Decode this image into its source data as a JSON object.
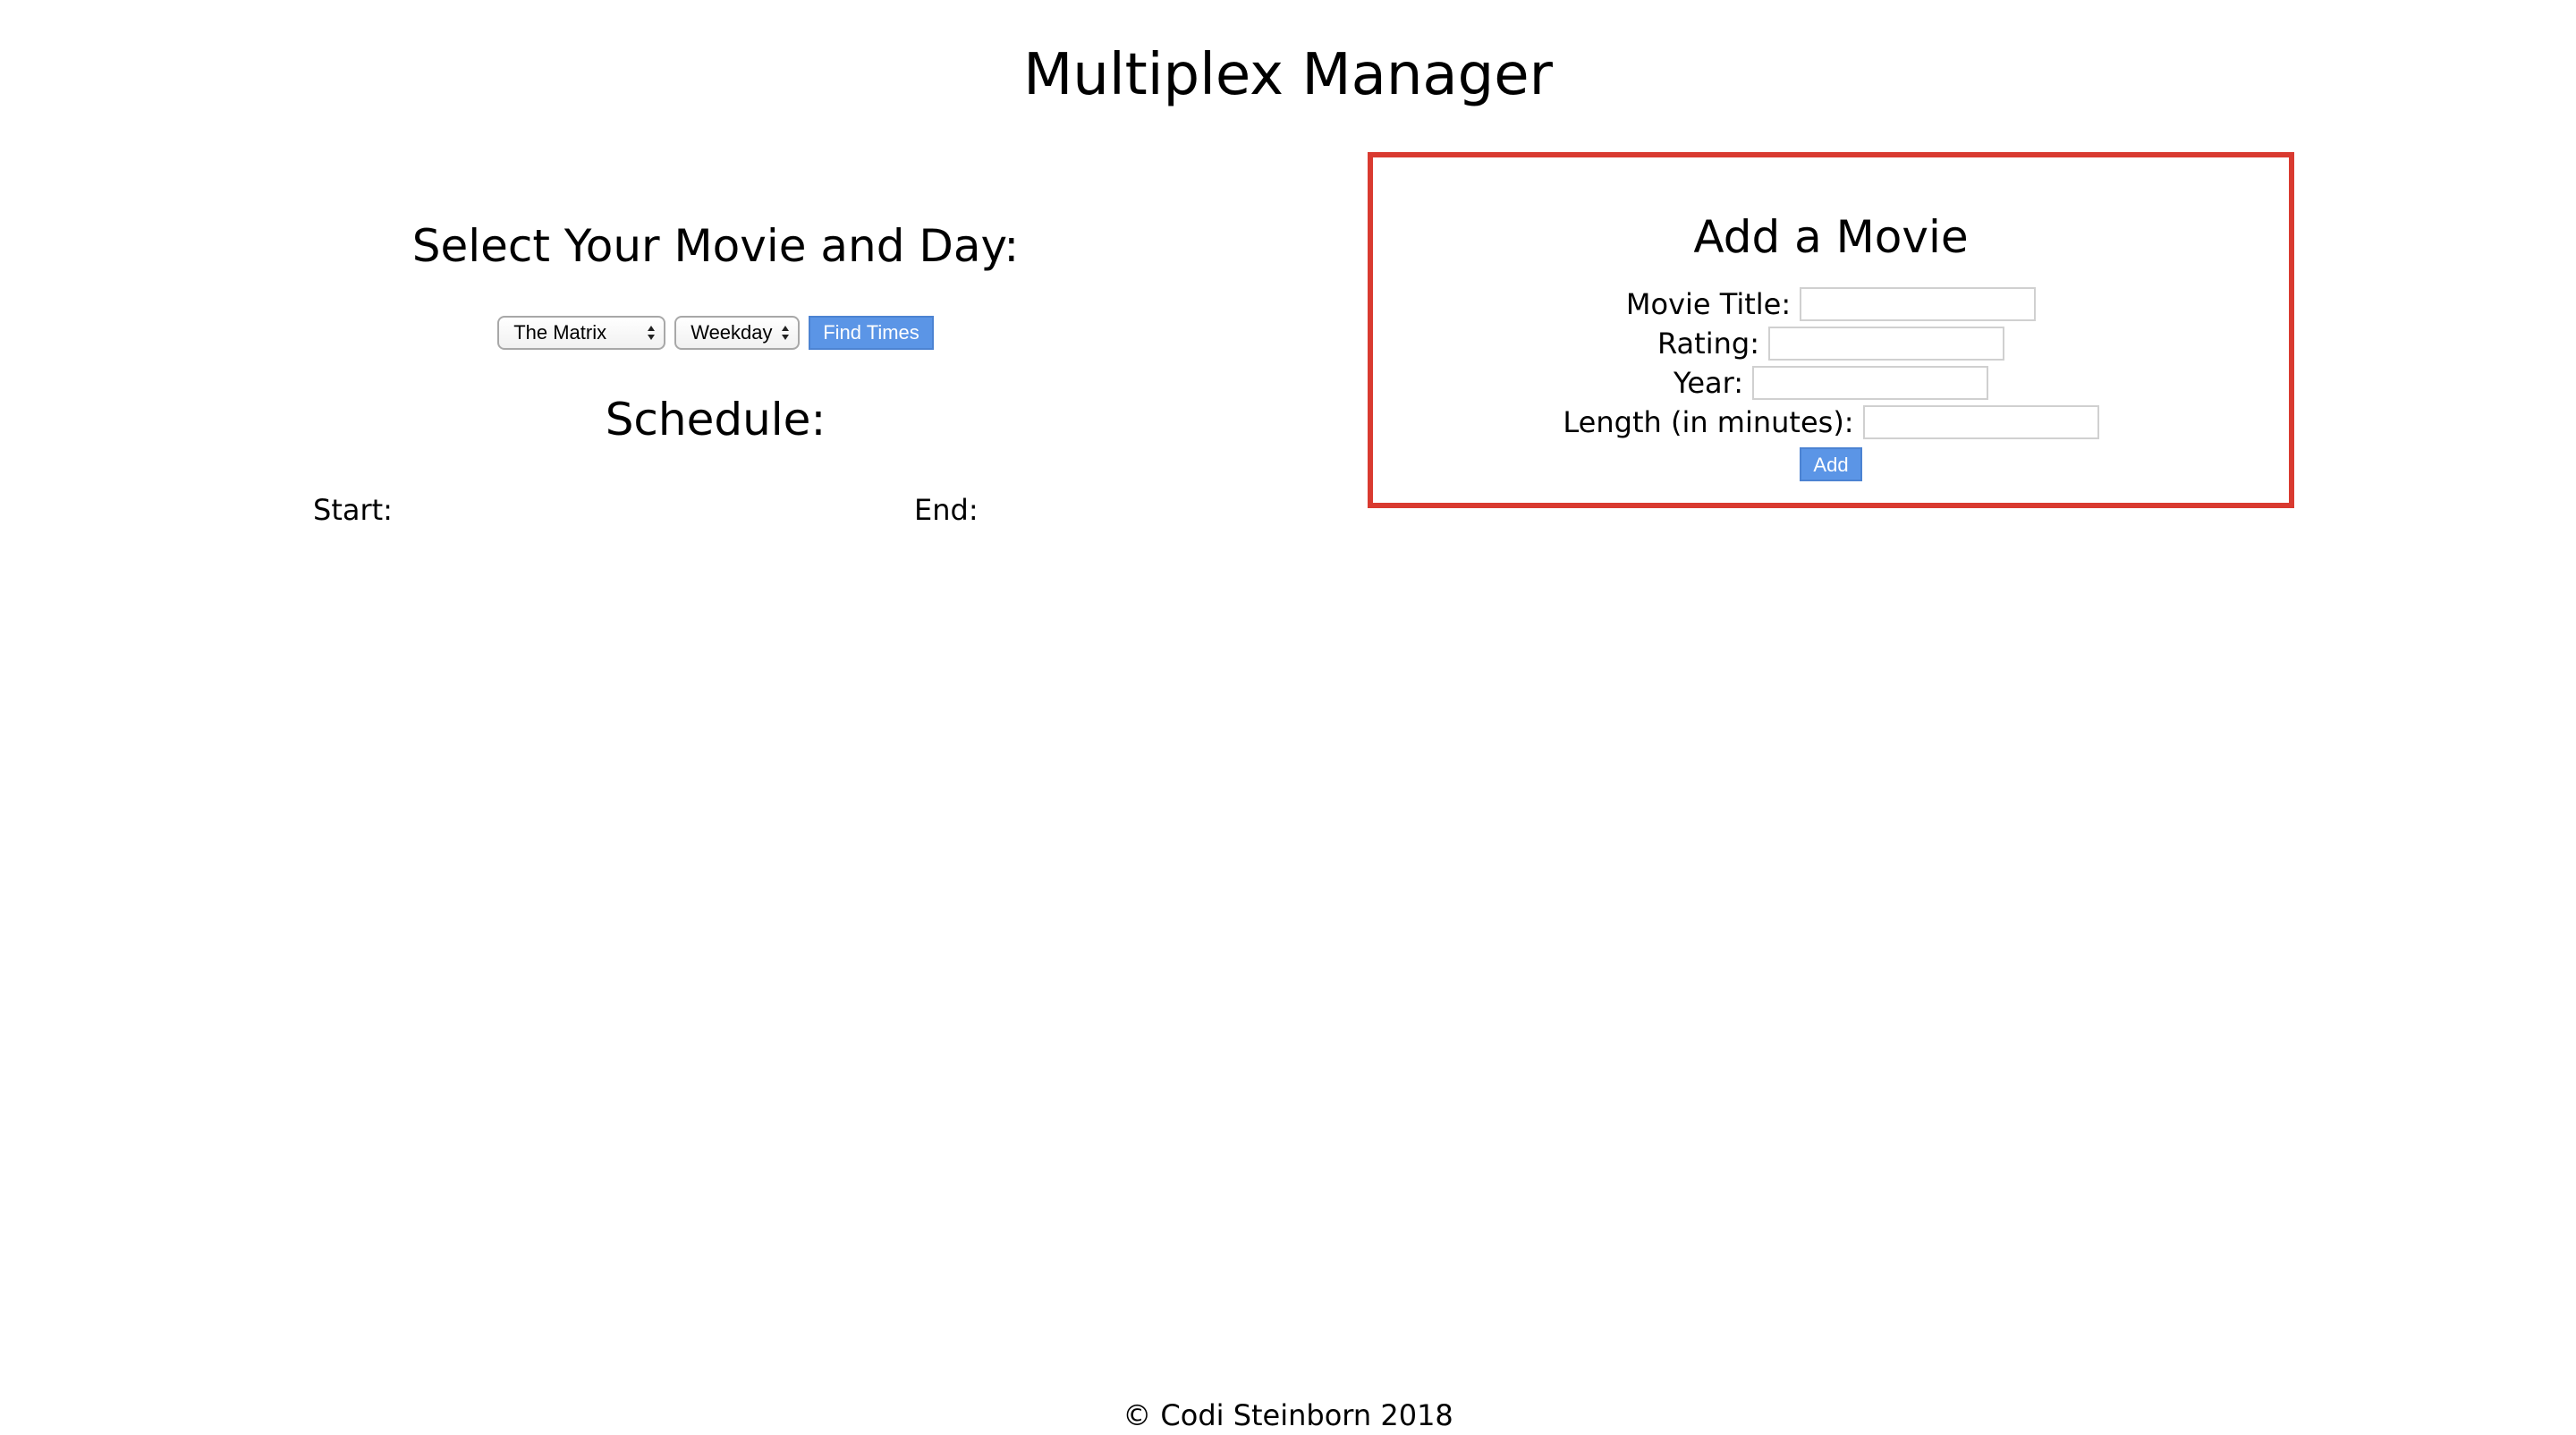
{
  "app": {
    "title": "Multiplex Manager"
  },
  "selector": {
    "heading": "Select Your Movie and Day:",
    "movie_value": "The Matrix",
    "day_value": "Weekday",
    "find_button": "Find Times"
  },
  "schedule": {
    "heading": "Schedule:",
    "start_label": "Start:",
    "end_label": "End:"
  },
  "add_movie": {
    "heading": "Add a Movie",
    "fields": {
      "title_label": "Movie Title:",
      "title_value": "",
      "rating_label": "Rating:",
      "rating_value": "",
      "year_label": "Year:",
      "year_value": "",
      "length_label": "Length (in minutes):",
      "length_value": ""
    },
    "add_button": "Add"
  },
  "footer": {
    "copyright": "© Codi Steinborn 2018"
  },
  "colors": {
    "button_blue": "#5b95e6",
    "panel_border_red": "#d93a30"
  },
  "icons": {
    "select_arrows": "up-down-chevron-icon"
  }
}
